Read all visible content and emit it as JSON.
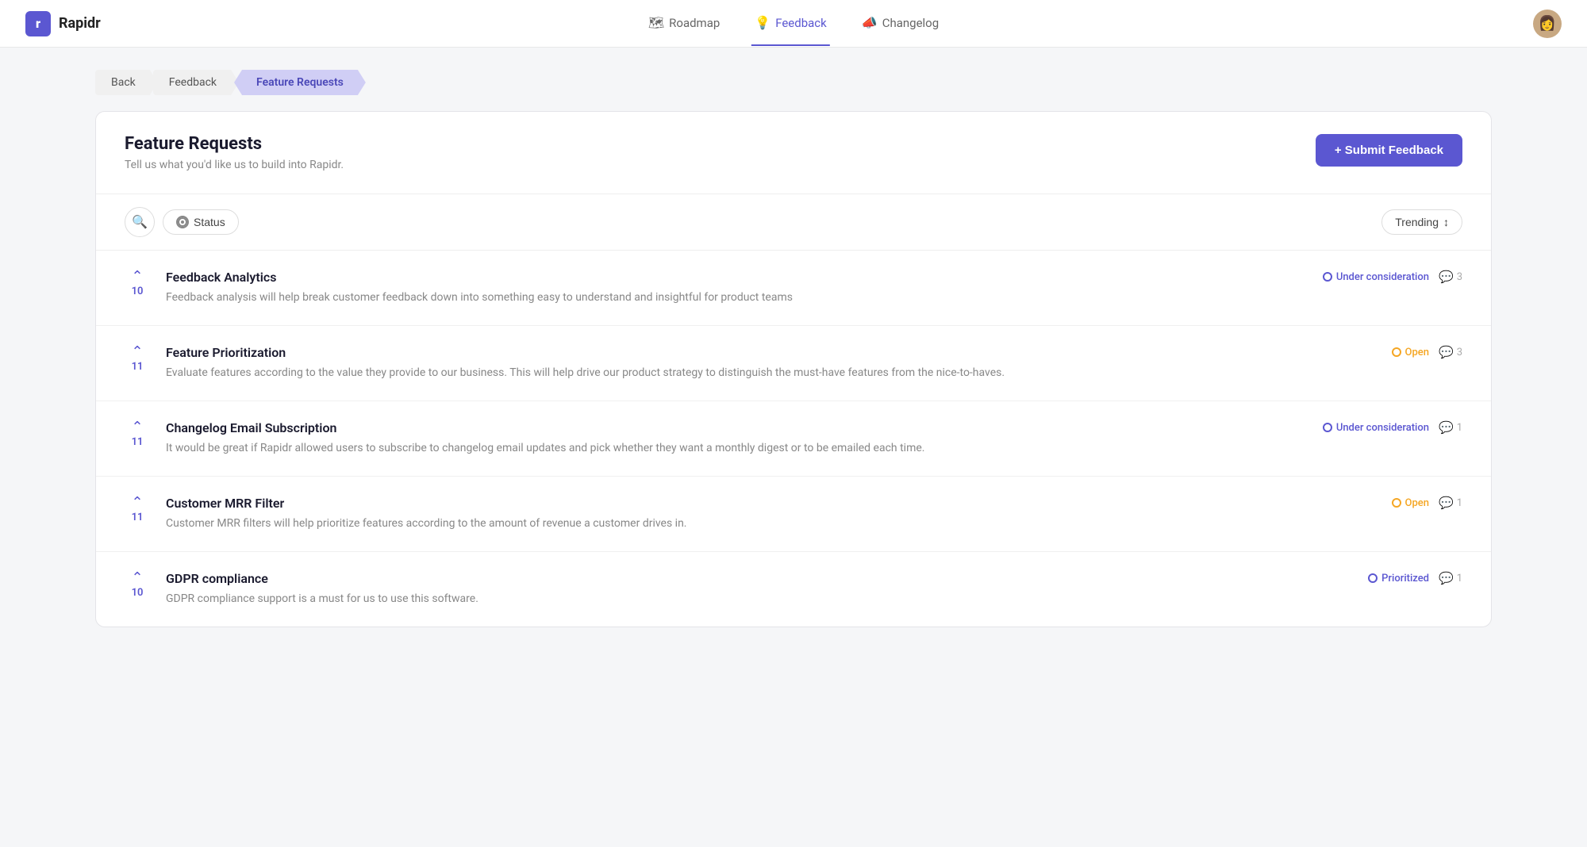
{
  "header": {
    "logo_letter": "r",
    "logo_text": "Rapidr",
    "nav": [
      {
        "id": "roadmap",
        "label": "Roadmap",
        "icon": "🗺",
        "active": false
      },
      {
        "id": "feedback",
        "label": "Feedback",
        "icon": "💡",
        "active": true
      },
      {
        "id": "changelog",
        "label": "Changelog",
        "icon": "📣",
        "active": false
      }
    ]
  },
  "breadcrumb": {
    "items": [
      {
        "id": "back",
        "label": "Back",
        "active": false
      },
      {
        "id": "feedback",
        "label": "Feedback",
        "active": false
      },
      {
        "id": "feature-requests",
        "label": "Feature Requests",
        "active": true
      }
    ]
  },
  "page": {
    "title": "Feature Requests",
    "subtitle": "Tell us what you'd like us to build into Rapidr.",
    "submit_button": "+ Submit Feedback",
    "filter_status_label": "Status",
    "sort_label": "Trending"
  },
  "feedback_items": [
    {
      "id": 1,
      "title": "Feedback Analytics",
      "description": "Feedback analysis will help break customer feedback down into something easy to understand and insightful for product teams",
      "votes": 10,
      "status": "Under consideration",
      "status_color": "blue",
      "comments": 3
    },
    {
      "id": 2,
      "title": "Feature Prioritization",
      "description": "Evaluate features according to the value they provide to our business. This will help drive our product strategy to distinguish the must-have features from the nice-to-haves.",
      "votes": 11,
      "status": "Open",
      "status_color": "orange",
      "comments": 3
    },
    {
      "id": 3,
      "title": "Changelog Email Subscription",
      "description": "It would be great if Rapidr allowed users to subscribe to changelog email updates and pick whether they want a monthly digest or to be emailed each time.",
      "votes": 11,
      "status": "Under consideration",
      "status_color": "blue",
      "comments": 1
    },
    {
      "id": 4,
      "title": "Customer MRR Filter",
      "description": "Customer MRR filters will help prioritize features according to the amount of revenue a customer drives in.",
      "votes": 11,
      "status": "Open",
      "status_color": "orange",
      "comments": 1
    },
    {
      "id": 5,
      "title": "GDPR compliance",
      "description": "GDPR compliance support is a must for us to use this software.",
      "votes": 10,
      "status": "Prioritized",
      "status_color": "blue",
      "comments": 1
    }
  ]
}
